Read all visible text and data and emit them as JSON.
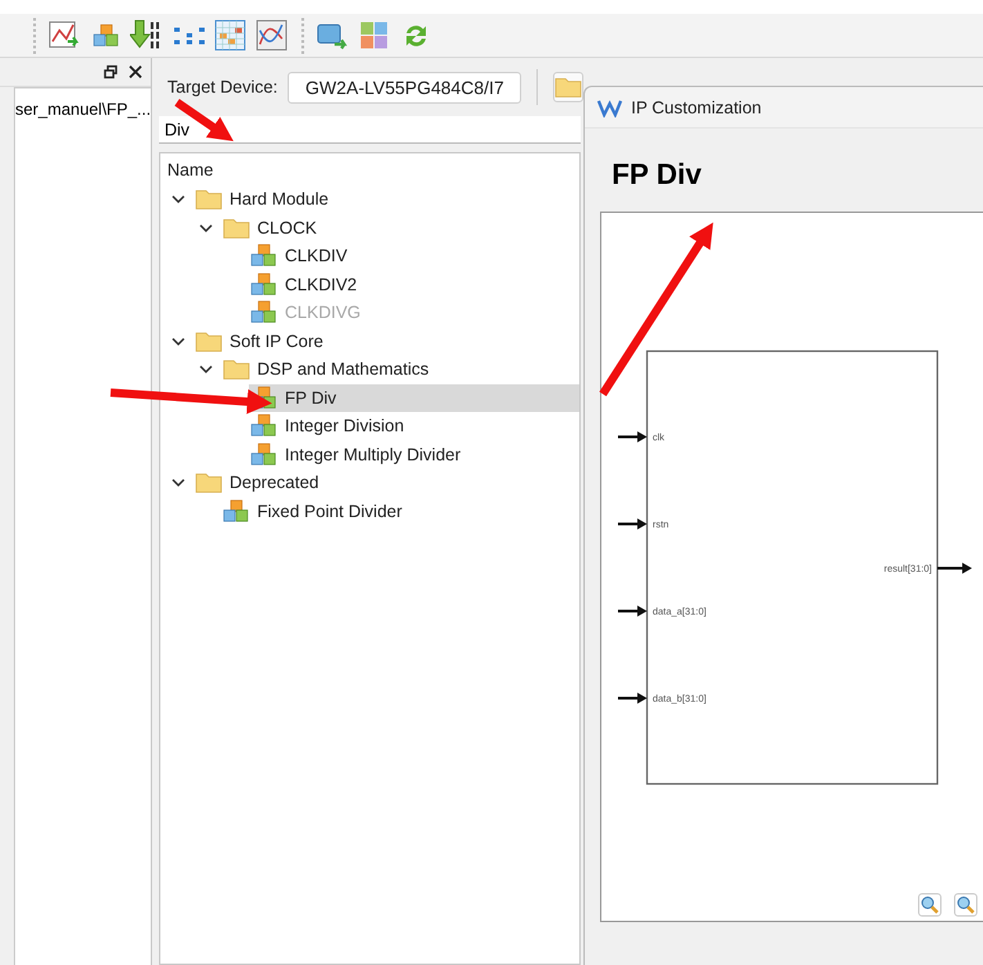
{
  "left_panel": {
    "path": "ser_manuel\\FP_..."
  },
  "target_device": {
    "label": "Target Device:",
    "value": "GW2A-LV55PG484C8/I7"
  },
  "search": {
    "value": "Div"
  },
  "tree": {
    "column": "Name",
    "items": [
      {
        "label": "Hard Module",
        "kind": "folder",
        "expanded": true,
        "selected": false,
        "disabled": false,
        "children": [
          {
            "label": "CLOCK",
            "kind": "folder",
            "expanded": true,
            "selected": false,
            "disabled": false,
            "children": [
              {
                "label": "CLKDIV",
                "kind": "ip",
                "selected": false,
                "disabled": false
              },
              {
                "label": "CLKDIV2",
                "kind": "ip",
                "selected": false,
                "disabled": false
              },
              {
                "label": "CLKDIVG",
                "kind": "ip",
                "selected": false,
                "disabled": true
              }
            ]
          }
        ]
      },
      {
        "label": "Soft IP Core",
        "kind": "folder",
        "expanded": true,
        "selected": false,
        "disabled": false,
        "children": [
          {
            "label": "DSP and Mathematics",
            "kind": "folder",
            "expanded": true,
            "selected": false,
            "disabled": false,
            "children": [
              {
                "label": "FP Div",
                "kind": "ip",
                "selected": true,
                "disabled": false
              },
              {
                "label": "Integer Division",
                "kind": "ip",
                "selected": false,
                "disabled": false
              },
              {
                "label": "Integer Multiply Divider",
                "kind": "ip",
                "selected": false,
                "disabled": false
              }
            ]
          }
        ]
      },
      {
        "label": "Deprecated",
        "kind": "folder",
        "expanded": true,
        "selected": false,
        "disabled": false,
        "children": [
          {
            "label": "Fixed Point Divider",
            "kind": "ip",
            "selected": false,
            "disabled": false
          }
        ]
      }
    ]
  },
  "dialog": {
    "title": "IP Customization",
    "heading": "FP Div",
    "inputs": [
      "clk",
      "rstn",
      "data_a[31:0]",
      "data_b[31:0]"
    ],
    "outputs": [
      "result[31:0]"
    ]
  }
}
